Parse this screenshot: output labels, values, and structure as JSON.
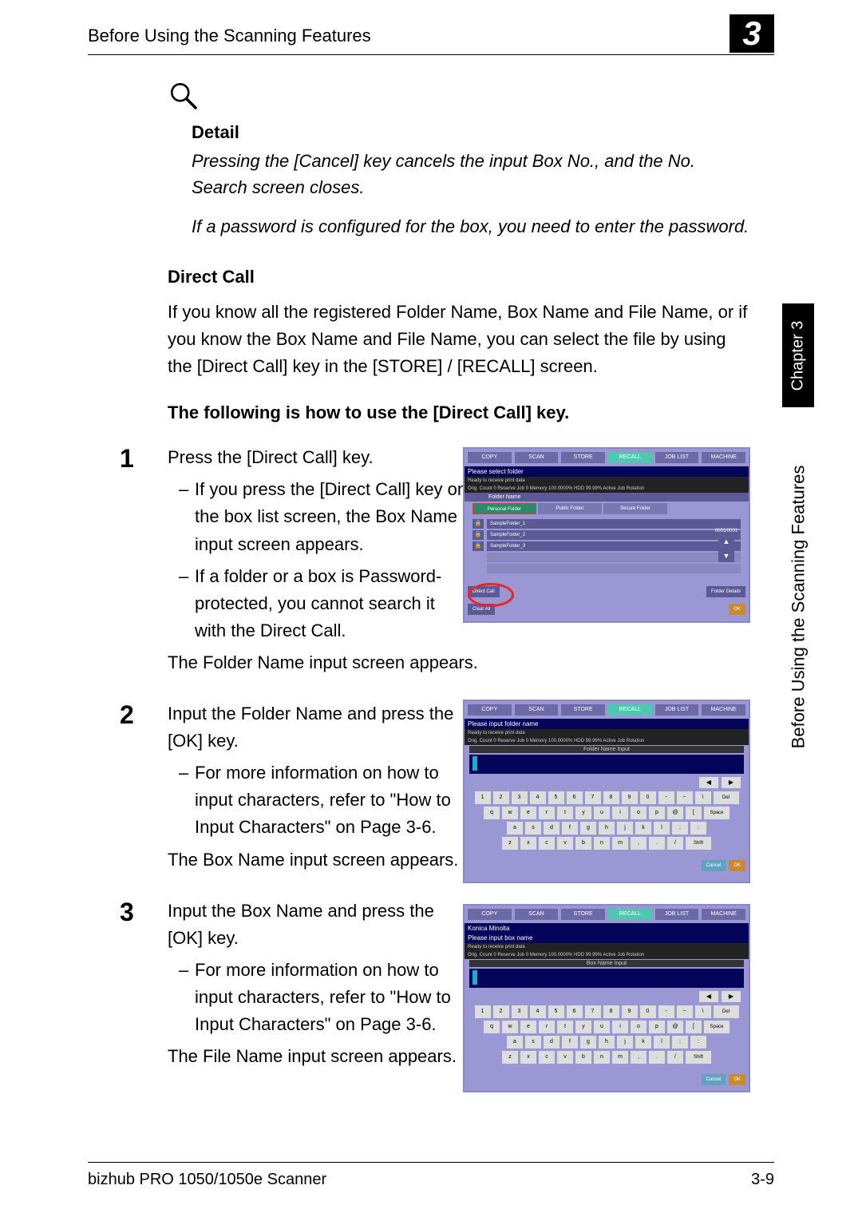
{
  "page": {
    "running_head": "Before Using the Scanning Features",
    "chapter_badge": "3",
    "side_tab": "Chapter 3",
    "side_label": "Before Using the Scanning Features",
    "footer_left": "bizhub PRO 1050/1050e Scanner",
    "footer_right": "3-9"
  },
  "detail": {
    "heading": "Detail",
    "para1": "Pressing the [Cancel] key cancels the input Box No., and the No. Search screen closes.",
    "para2": "If a password is configured for the box, you need to enter the password."
  },
  "direct_call": {
    "heading": "Direct Call",
    "intro": "If you know all the registered Folder Name, Box Name and File Name, or if you know the Box Name and File Name, you can select the file by using the [Direct Call] key in the [STORE] / [RECALL] screen.",
    "subheading": "The following is how to use the [Direct Call] key."
  },
  "steps": [
    {
      "num": "1",
      "lead": "Press the [Direct Call] key.",
      "bullets": [
        "If you press the [Direct Call] key on the box list screen, the Box Name input screen appears.",
        "If a folder or a box is Password-protected, you cannot search it with the Direct Call."
      ],
      "after": "The Folder Name input screen appears."
    },
    {
      "num": "2",
      "lead": "Input the Folder Name and press the [OK] key.",
      "bullets": [
        "For more information on how to input characters, refer to \"How to Input Characters\" on Page 3-6."
      ],
      "after": "The Box Name input screen appears."
    },
    {
      "num": "3",
      "lead": "Input the Box Name and press the [OK] key.",
      "bullets": [
        "For more information on how to input characters, refer to \"How to Input Characters\" on Page 3-6."
      ],
      "after": "The File Name input screen appears."
    }
  ],
  "fig_common": {
    "tabs": [
      "COPY",
      "SCAN",
      "STORE",
      "RECALL",
      "JOB LIST",
      "MACHINE"
    ],
    "status_left": "Ready to receive print data",
    "status_row": "Orig. Count 0  Reserve Job 0  Memory 100.0000% HDD 99.99% Active Job Rotation",
    "ok": "OK",
    "cancel": "Cancel"
  },
  "fig1": {
    "title": "Please select folder",
    "header": "Folder Name",
    "folder_tabs": [
      "Personal Folder",
      "Public Folder",
      "Secure Folder"
    ],
    "rows": [
      "SampleFolder_1",
      "SampleFolder_2",
      "SampleFolder_3"
    ],
    "pager": "0001/0001",
    "btn_direct": "Direct Call",
    "btn_details": "Folder Details",
    "btn_clear": "Clear All"
  },
  "fig2": {
    "title": "Please input folder name",
    "header": "Folder Name Input",
    "del": "Del",
    "space": "Space",
    "shift": "Shift"
  },
  "fig3": {
    "title_a": "Konica Minolta",
    "title_b": "Please input box name",
    "header": "Box Name Input",
    "del": "Del",
    "space": "Space",
    "shift": "Shift"
  },
  "kb": {
    "row1": [
      "1",
      "2",
      "3",
      "4",
      "5",
      "6",
      "7",
      "8",
      "9",
      "0",
      "-",
      "~",
      "\\"
    ],
    "row2": [
      "q",
      "w",
      "e",
      "r",
      "t",
      "y",
      "u",
      "i",
      "o",
      "p",
      "@",
      "["
    ],
    "row3": [
      "a",
      "s",
      "d",
      "f",
      "g",
      "h",
      "j",
      "k",
      "l",
      ";",
      ":"
    ],
    "row4": [
      "z",
      "x",
      "c",
      "v",
      "b",
      "n",
      "m",
      ",",
      ".",
      "/"
    ]
  }
}
